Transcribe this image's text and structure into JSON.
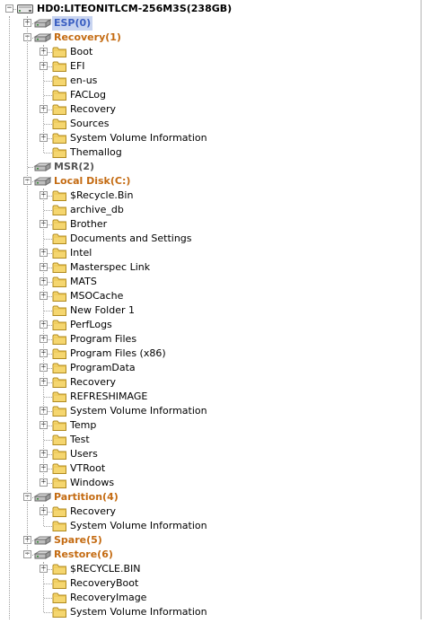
{
  "root": {
    "label": "HD0:LITEONITLCM-256M3S(238GB)",
    "icon": "hard-disk-icon",
    "expanded": true
  },
  "partitions": [
    {
      "label": "ESP(0)",
      "selected": true,
      "expanded": false,
      "expandable": true,
      "dim": false,
      "children": []
    },
    {
      "label": "Recovery(1)",
      "selected": false,
      "expanded": true,
      "expandable": true,
      "dim": false,
      "children": [
        {
          "label": "Boot",
          "expandable": true
        },
        {
          "label": "EFI",
          "expandable": true
        },
        {
          "label": "en-us",
          "expandable": false
        },
        {
          "label": "FACLog",
          "expandable": false
        },
        {
          "label": "Recovery",
          "expandable": true
        },
        {
          "label": "Sources",
          "expandable": false
        },
        {
          "label": "System Volume Information",
          "expandable": true
        },
        {
          "label": "Themallog",
          "expandable": false
        }
      ]
    },
    {
      "label": "MSR(2)",
      "selected": false,
      "expanded": false,
      "expandable": false,
      "dim": true,
      "children": []
    },
    {
      "label": "Local Disk(C:)",
      "selected": false,
      "expanded": true,
      "expandable": true,
      "dim": false,
      "children": [
        {
          "label": "$Recycle.Bin",
          "expandable": true
        },
        {
          "label": "archive_db",
          "expandable": false
        },
        {
          "label": "Brother",
          "expandable": true
        },
        {
          "label": "Documents and Settings",
          "expandable": false
        },
        {
          "label": "Intel",
          "expandable": true
        },
        {
          "label": "Masterspec Link",
          "expandable": true
        },
        {
          "label": "MATS",
          "expandable": true
        },
        {
          "label": "MSOCache",
          "expandable": true
        },
        {
          "label": "New Folder 1",
          "expandable": false
        },
        {
          "label": "PerfLogs",
          "expandable": true
        },
        {
          "label": "Program Files",
          "expandable": true
        },
        {
          "label": "Program Files (x86)",
          "expandable": true
        },
        {
          "label": "ProgramData",
          "expandable": true
        },
        {
          "label": "Recovery",
          "expandable": true
        },
        {
          "label": "REFRESHIMAGE",
          "expandable": false
        },
        {
          "label": "System Volume Information",
          "expandable": true
        },
        {
          "label": "Temp",
          "expandable": true
        },
        {
          "label": "Test",
          "expandable": false
        },
        {
          "label": "Users",
          "expandable": true
        },
        {
          "label": "VTRoot",
          "expandable": true
        },
        {
          "label": "Windows",
          "expandable": true
        }
      ]
    },
    {
      "label": "Partition(4)",
      "selected": false,
      "expanded": true,
      "expandable": true,
      "dim": false,
      "children": [
        {
          "label": "Recovery",
          "expandable": true
        },
        {
          "label": "System Volume Information",
          "expandable": false
        }
      ]
    },
    {
      "label": "Spare(5)",
      "selected": false,
      "expanded": false,
      "expandable": true,
      "dim": false,
      "children": []
    },
    {
      "label": "Restore(6)",
      "selected": false,
      "expanded": true,
      "expandable": true,
      "dim": false,
      "children": [
        {
          "label": "$RECYCLE.BIN",
          "expandable": true
        },
        {
          "label": "RecoveryBoot",
          "expandable": false
        },
        {
          "label": "RecoveryImage",
          "expandable": false
        },
        {
          "label": "System Volume Information",
          "expandable": false
        }
      ]
    }
  ],
  "colors": {
    "partition_text": "#c46b12",
    "selected_text": "#3b5fc2",
    "selected_bg": "#c8d4f0",
    "folder_fill": "#f5d66f",
    "folder_stroke": "#b08a1f"
  },
  "icons": {
    "folder": "folder-icon",
    "partition": "partition-drive-icon",
    "disk": "hard-disk-icon"
  }
}
